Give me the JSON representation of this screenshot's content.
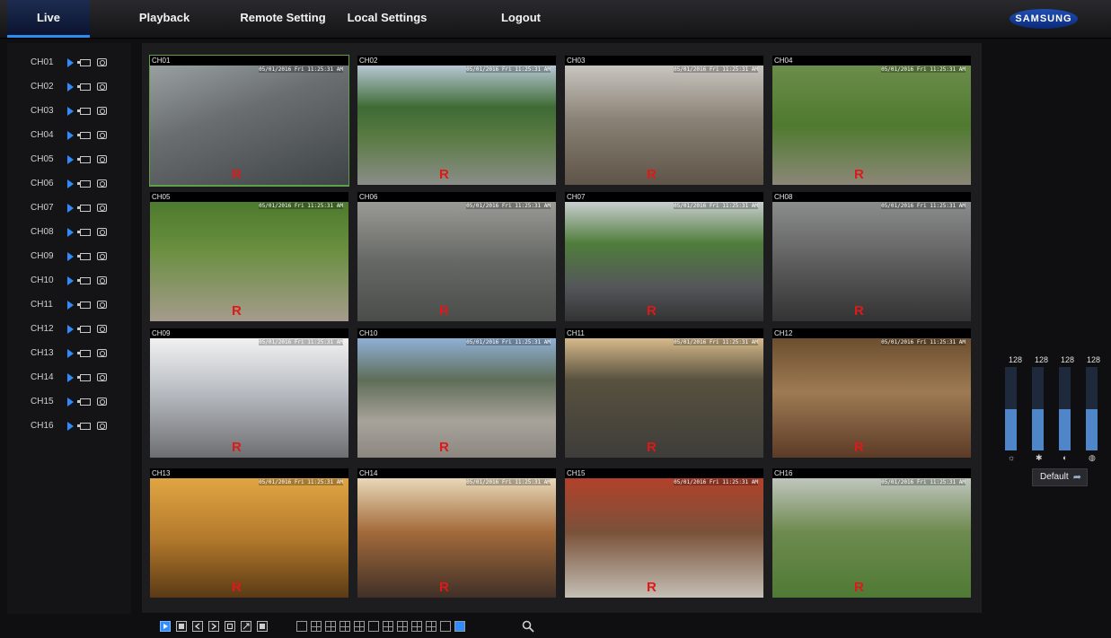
{
  "nav": {
    "items": [
      "Live",
      "Playback",
      "Remote Setting",
      "Local Settings",
      "Logout"
    ],
    "active": "Live"
  },
  "brand": {
    "logo_text": "SAMSUNG"
  },
  "channels": [
    "CH01",
    "CH02",
    "CH03",
    "CH04",
    "CH05",
    "CH06",
    "CH07",
    "CH08",
    "CH09",
    "CH10",
    "CH11",
    "CH12",
    "CH13",
    "CH14",
    "CH15",
    "CH16"
  ],
  "grid": {
    "selected": "CH01",
    "recording_marker": "R",
    "osd_timestamp": "05/01/2016 Fri 11:25:31 AM",
    "cells": [
      {
        "label": "CH01",
        "scene": "highway"
      },
      {
        "label": "CH02",
        "scene": "parking-trees"
      },
      {
        "label": "CH03",
        "scene": "atrium"
      },
      {
        "label": "CH04",
        "scene": "garden"
      },
      {
        "label": "CH05",
        "scene": "path"
      },
      {
        "label": "CH06",
        "scene": "crosswalk"
      },
      {
        "label": "CH07",
        "scene": "boulevard"
      },
      {
        "label": "CH08",
        "scene": "traffic"
      },
      {
        "label": "CH09",
        "scene": "station"
      },
      {
        "label": "CH10",
        "scene": "plaza"
      },
      {
        "label": "CH11",
        "scene": "parking-lot"
      },
      {
        "label": "CH12",
        "scene": "living-room"
      },
      {
        "label": "CH13",
        "scene": "mall-night"
      },
      {
        "label": "CH14",
        "scene": "shop"
      },
      {
        "label": "CH15",
        "scene": "hall"
      },
      {
        "label": "CH16",
        "scene": "courtyard"
      }
    ]
  },
  "adjust": {
    "values": [
      "128",
      "128",
      "128",
      "128"
    ],
    "levels": [
      0.5,
      0.5,
      0.5,
      0.5
    ],
    "icons": [
      "brightness-icon",
      "hue-icon",
      "contrast-icon",
      "saturation-icon"
    ],
    "default_label": "Default"
  },
  "colors": {
    "accent": "#2f8cff",
    "recording": "#e01818",
    "selected_border": "#5fa14b"
  }
}
